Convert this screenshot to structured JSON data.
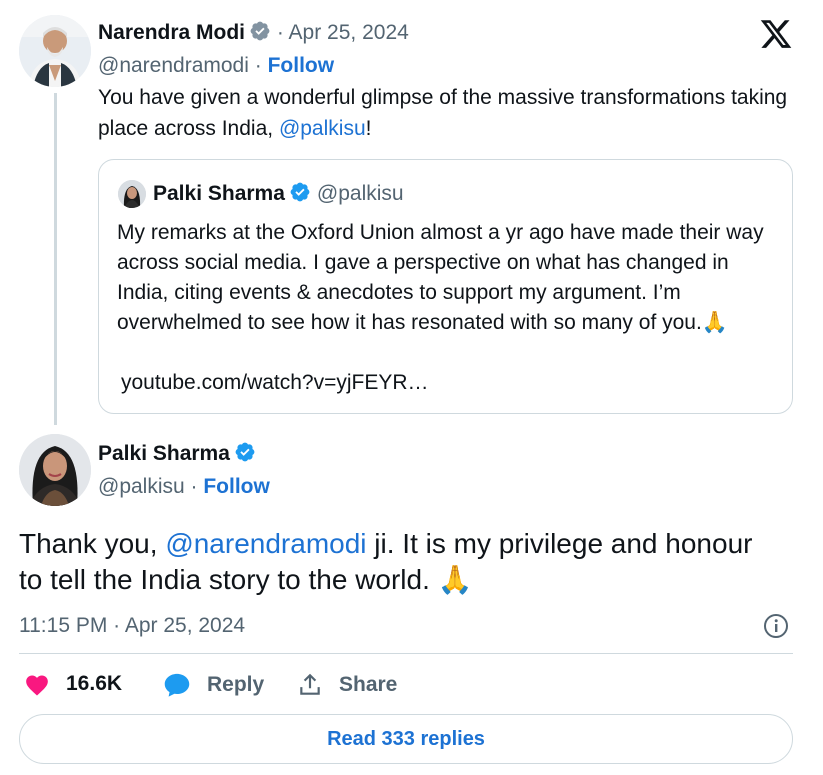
{
  "parent_tweet": {
    "author_name": "Narendra Modi",
    "handle": "@narendramodi",
    "separator": " · ",
    "date": "Apr 25, 2024",
    "follow_label": "Follow",
    "text_before": "You have given a wonderful glimpse of the massive transformations taking place across India, ",
    "mention": "@palkisu",
    "text_after": "!"
  },
  "quoted_tweet": {
    "author_name": "Palki Sharma",
    "handle": "@palkisu",
    "text": "My remarks at the Oxford Union almost a yr ago have made their way across social media. I gave a perspective on what has changed in India, citing events & anecdotes to support my argument. I’m overwhelmed to see how it has resonated with so many of you.🙏",
    "link": "youtube.com/watch?v=yjFEYR…"
  },
  "main_tweet": {
    "author_name": "Palki Sharma",
    "handle": "@palkisu",
    "follow_label": "Follow",
    "text_before": "Thank you, ",
    "mention": "@narendramodi",
    "text_after": " ji. It is my privilege and honour to tell the India story to the world. 🙏",
    "timestamp": "11:15 PM · Apr 25, 2024"
  },
  "actions": {
    "likes": "16.6K",
    "reply_label": "Reply",
    "share_label": "Share"
  },
  "read_replies_label": "Read 333 replies",
  "colors": {
    "link": "#1d72d3",
    "verified": "#1d9bf0",
    "like": "#f91880",
    "reply_bubble": "#1d9bf0"
  },
  "icons": {
    "brand": "x-logo-icon",
    "verified": "verified-badge-icon",
    "like": "heart-icon",
    "reply": "chat-bubble-icon",
    "share": "share-upload-icon",
    "info": "info-icon"
  }
}
